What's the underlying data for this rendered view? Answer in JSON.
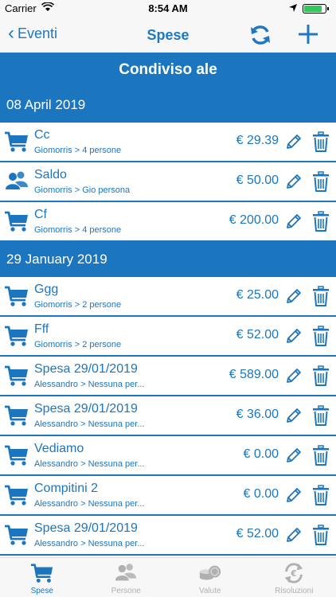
{
  "status_bar": {
    "carrier": "Carrier",
    "time": "8:54 AM"
  },
  "nav": {
    "back_label": "Eventi",
    "title": "Spese"
  },
  "header": {
    "title": "Condiviso ale"
  },
  "sections": [
    {
      "date": "08 April 2019",
      "rows": [
        {
          "icon": "cart-icon",
          "title": "Cc",
          "subtitle": "Giomorris > 4 persone",
          "amount": "€ 29.39"
        },
        {
          "icon": "people-icon",
          "title": "Saldo",
          "subtitle": "Giomorris > Gio persona",
          "amount": "€ 50.00"
        },
        {
          "icon": "cart-icon",
          "title": "Cf",
          "subtitle": "Giomorris > 4 persone",
          "amount": "€ 200.00"
        }
      ]
    },
    {
      "date": "29 January 2019",
      "rows": [
        {
          "icon": "cart-icon",
          "title": "Ggg",
          "subtitle": "Giomorris > 2 persone",
          "amount": "€ 25.00"
        },
        {
          "icon": "cart-icon",
          "title": "Fff",
          "subtitle": "Giomorris > 2 persone",
          "amount": "€ 52.00"
        },
        {
          "icon": "cart-icon",
          "title": "Spesa 29/01/2019",
          "subtitle": "Alessandro  >  Nessuna per...",
          "amount": "€ 589.00"
        },
        {
          "icon": "cart-icon",
          "title": "Spesa 29/01/2019",
          "subtitle": "Alessandro  >  Nessuna per...",
          "amount": "€ 36.00"
        },
        {
          "icon": "cart-icon",
          "title": "Vediamo",
          "subtitle": "Alessandro  >  Nessuna per...",
          "amount": "€ 0.00"
        },
        {
          "icon": "cart-icon",
          "title": "Compitini 2",
          "subtitle": "Alessandro  >  Nessuna per...",
          "amount": "€ 0.00"
        },
        {
          "icon": "cart-icon",
          "title": "Spesa 29/01/2019",
          "subtitle": "Alessandro  >  Nessuna per...",
          "amount": "€ 52.00"
        }
      ]
    }
  ],
  "tabs": [
    {
      "label": "Spese",
      "icon": "cart-icon",
      "active": true
    },
    {
      "label": "Persone",
      "icon": "people-icon",
      "active": false
    },
    {
      "label": "Valute",
      "icon": "coins-icon",
      "active": false
    },
    {
      "label": "Risoluzioni",
      "icon": "exchange-icon",
      "active": false
    }
  ],
  "colors": {
    "accent": "#1c76bf",
    "inactive": "#b0b0b0",
    "bar_bg": "#f7f7f7"
  }
}
